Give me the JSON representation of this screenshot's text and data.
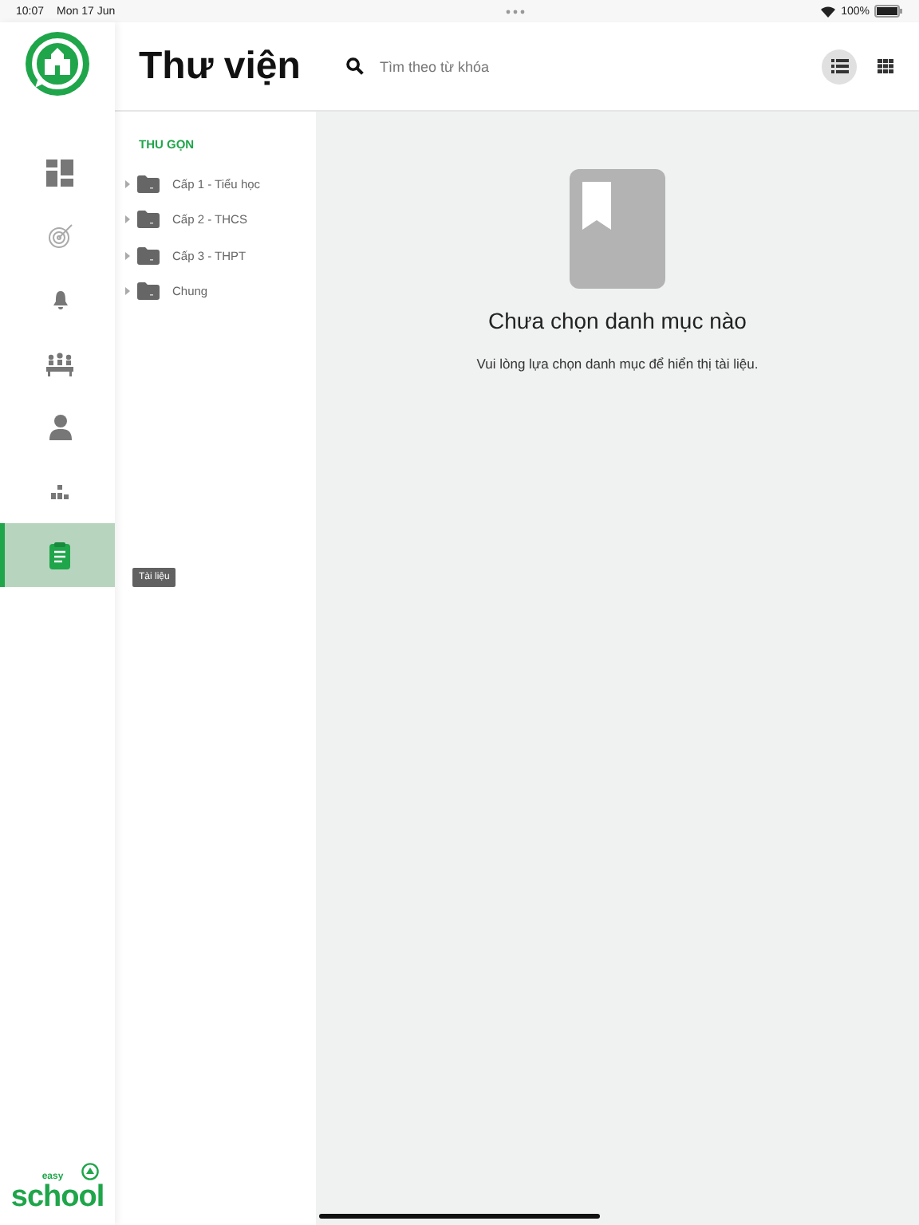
{
  "status_bar": {
    "time": "10:07",
    "date": "Mon 17 Jun",
    "battery": "100%"
  },
  "sidebar": {
    "items": [
      {
        "kind": "dashboard",
        "selected": false
      },
      {
        "kind": "target",
        "selected": false
      },
      {
        "kind": "bell",
        "selected": false
      },
      {
        "kind": "classroom",
        "selected": false
      },
      {
        "kind": "person",
        "selected": false
      },
      {
        "kind": "hierarchy",
        "selected": false
      },
      {
        "kind": "document",
        "selected": true,
        "tooltip": "Tài liệu"
      }
    ],
    "brand": {
      "small": "easy",
      "large": "school"
    }
  },
  "header": {
    "title": "Thư viện",
    "search": {
      "placeholder": "Tìm theo từ khóa"
    },
    "view_toggles": [
      {
        "kind": "list",
        "selected": true
      },
      {
        "kind": "grid",
        "selected": false
      }
    ]
  },
  "tree": {
    "collapse_label": "THU GỌN",
    "folders": [
      {
        "label": "Cấp 1 - Tiểu học",
        "expanded": false
      },
      {
        "label": "Cấp 2 - THCS",
        "expanded": false
      },
      {
        "label": "Cấp 3 - THPT",
        "expanded": false
      },
      {
        "label": "Chung",
        "expanded": false
      }
    ]
  },
  "empty_state": {
    "title": "Chưa chọn danh mục nào",
    "message": "Vui lòng lựa chọn danh mục để hiển thị tài liệu."
  }
}
